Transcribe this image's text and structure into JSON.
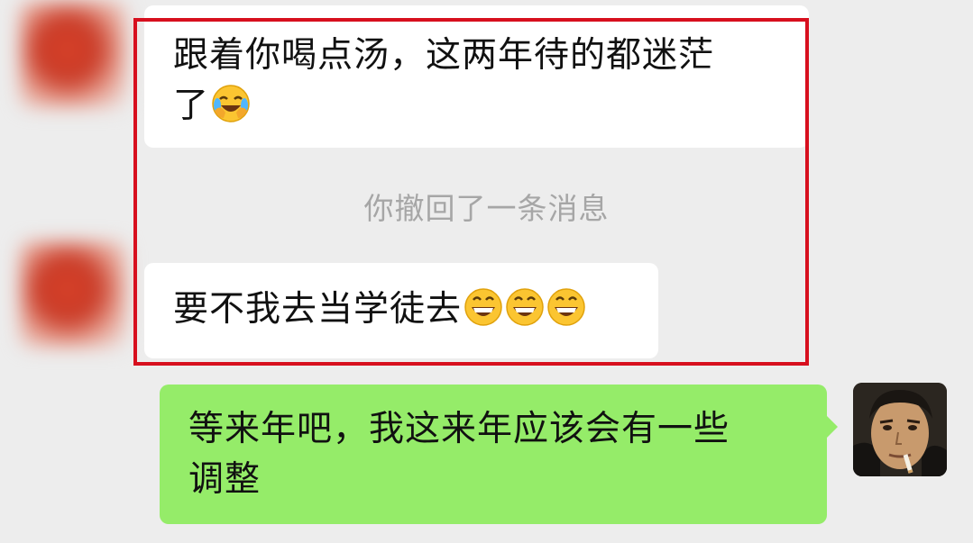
{
  "chat": {
    "messages": [
      {
        "sender": "other",
        "text": "跟着你喝点汤，这两年待的都迷茫了",
        "emojis": [
          "laugh-cry-emoji"
        ]
      },
      {
        "type": "system",
        "text": "你撤回了一条消息"
      },
      {
        "sender": "other",
        "text": "要不我去当学徒去",
        "emojis": [
          "grin-emoji",
          "grin-emoji",
          "grin-emoji"
        ]
      },
      {
        "sender": "self",
        "text": "等来年吧，我这来年应该会有一些调整"
      }
    ]
  },
  "msg1": {
    "line1": "跟着你喝点汤，这两年待的都迷茫",
    "line2": "了"
  },
  "system": {
    "recall_text": "你撤回了一条消息"
  },
  "msg2": {
    "text": "要不我去当学徒去"
  },
  "msg3": {
    "line1": "等来年吧，我这来年应该会有一些",
    "line2": "调整"
  },
  "colors": {
    "background": "#ededed",
    "incoming_bubble": "#ffffff",
    "outgoing_bubble": "#95ec69",
    "highlight_border": "#d70f1e",
    "system_text": "#a6a6a6"
  }
}
